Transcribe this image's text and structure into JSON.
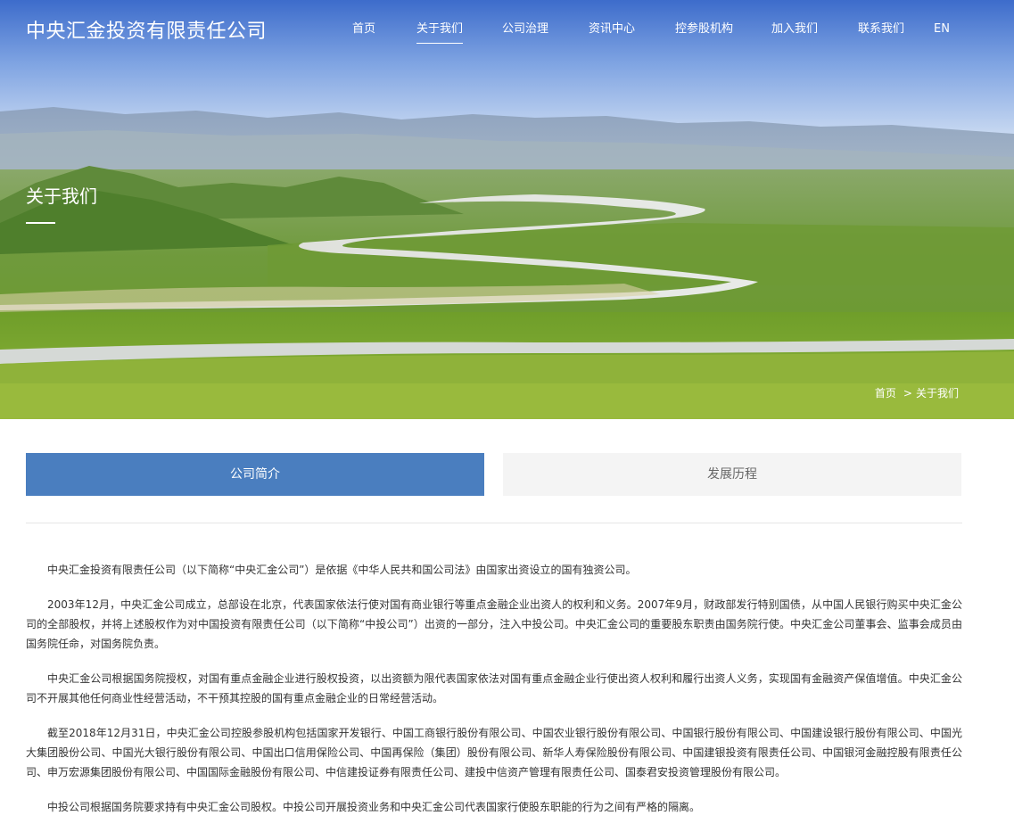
{
  "header": {
    "logo": "中央汇金投资有限责任公司",
    "nav": [
      {
        "label": "首页",
        "active": false
      },
      {
        "label": "关于我们",
        "active": true
      },
      {
        "label": "公司治理",
        "active": false
      },
      {
        "label": "资讯中心",
        "active": false
      },
      {
        "label": "控参股机构",
        "active": false
      },
      {
        "label": "加入我们",
        "active": false
      },
      {
        "label": "联系我们",
        "active": false
      },
      {
        "label": "EN",
        "active": false
      }
    ]
  },
  "hero": {
    "title": "关于我们",
    "breadcrumb": {
      "home": "首页",
      "separator": ">",
      "current": "关于我们"
    }
  },
  "tabs": [
    {
      "label": "公司简介",
      "active": true
    },
    {
      "label": "发展历程",
      "active": false
    }
  ],
  "content": {
    "paragraphs": [
      "中央汇金投资有限责任公司（以下简称“中央汇金公司”）是依据《中华人民共和国公司法》由国家出资设立的国有独资公司。",
      "2003年12月，中央汇金公司成立，总部设在北京，代表国家依法行使对国有商业银行等重点金融企业出资人的权利和义务。2007年9月，财政部发行特别国债，从中国人民银行购买中央汇金公司的全部股权，并将上述股权作为对中国投资有限责任公司（以下简称“中投公司”）出资的一部分，注入中投公司。中央汇金公司的重要股东职责由国务院行使。中央汇金公司董事会、监事会成员由国务院任命，对国务院负责。",
      "中央汇金公司根据国务院授权，对国有重点金融企业进行股权投资，以出资额为限代表国家依法对国有重点金融企业行使出资人权利和履行出资人义务，实现国有金融资产保值增值。中央汇金公司不开展其他任何商业性经营活动，不干预其控股的国有重点金融企业的日常经营活动。",
      "截至2018年12月31日，中央汇金公司控股参股机构包括国家开发银行、中国工商银行股份有限公司、中国农业银行股份有限公司、中国银行股份有限公司、中国建设银行股份有限公司、中国光大集团股份公司、中国光大银行股份有限公司、中国出口信用保险公司、中国再保险（集团）股份有限公司、新华人寿保险股份有限公司、中国建银投资有限责任公司、中国银河金融控股有限责任公司、申万宏源集团股份有限公司、中国国际金融股份有限公司、中信建投证券有限责任公司、建投中信资产管理有限责任公司、国泰君安投资管理股份有限公司。",
      "中投公司根据国务院要求持有中央汇金公司股权。中投公司开展投资业务和中央汇金公司代表国家行使股东职能的行为之间有严格的隔离。"
    ]
  },
  "colors": {
    "accent": "#4a7ebf",
    "inactive_tab_bg": "#f4f4f4",
    "inactive_tab_text": "#666666",
    "body_text": "#333333",
    "divider": "#e6e6e6"
  }
}
